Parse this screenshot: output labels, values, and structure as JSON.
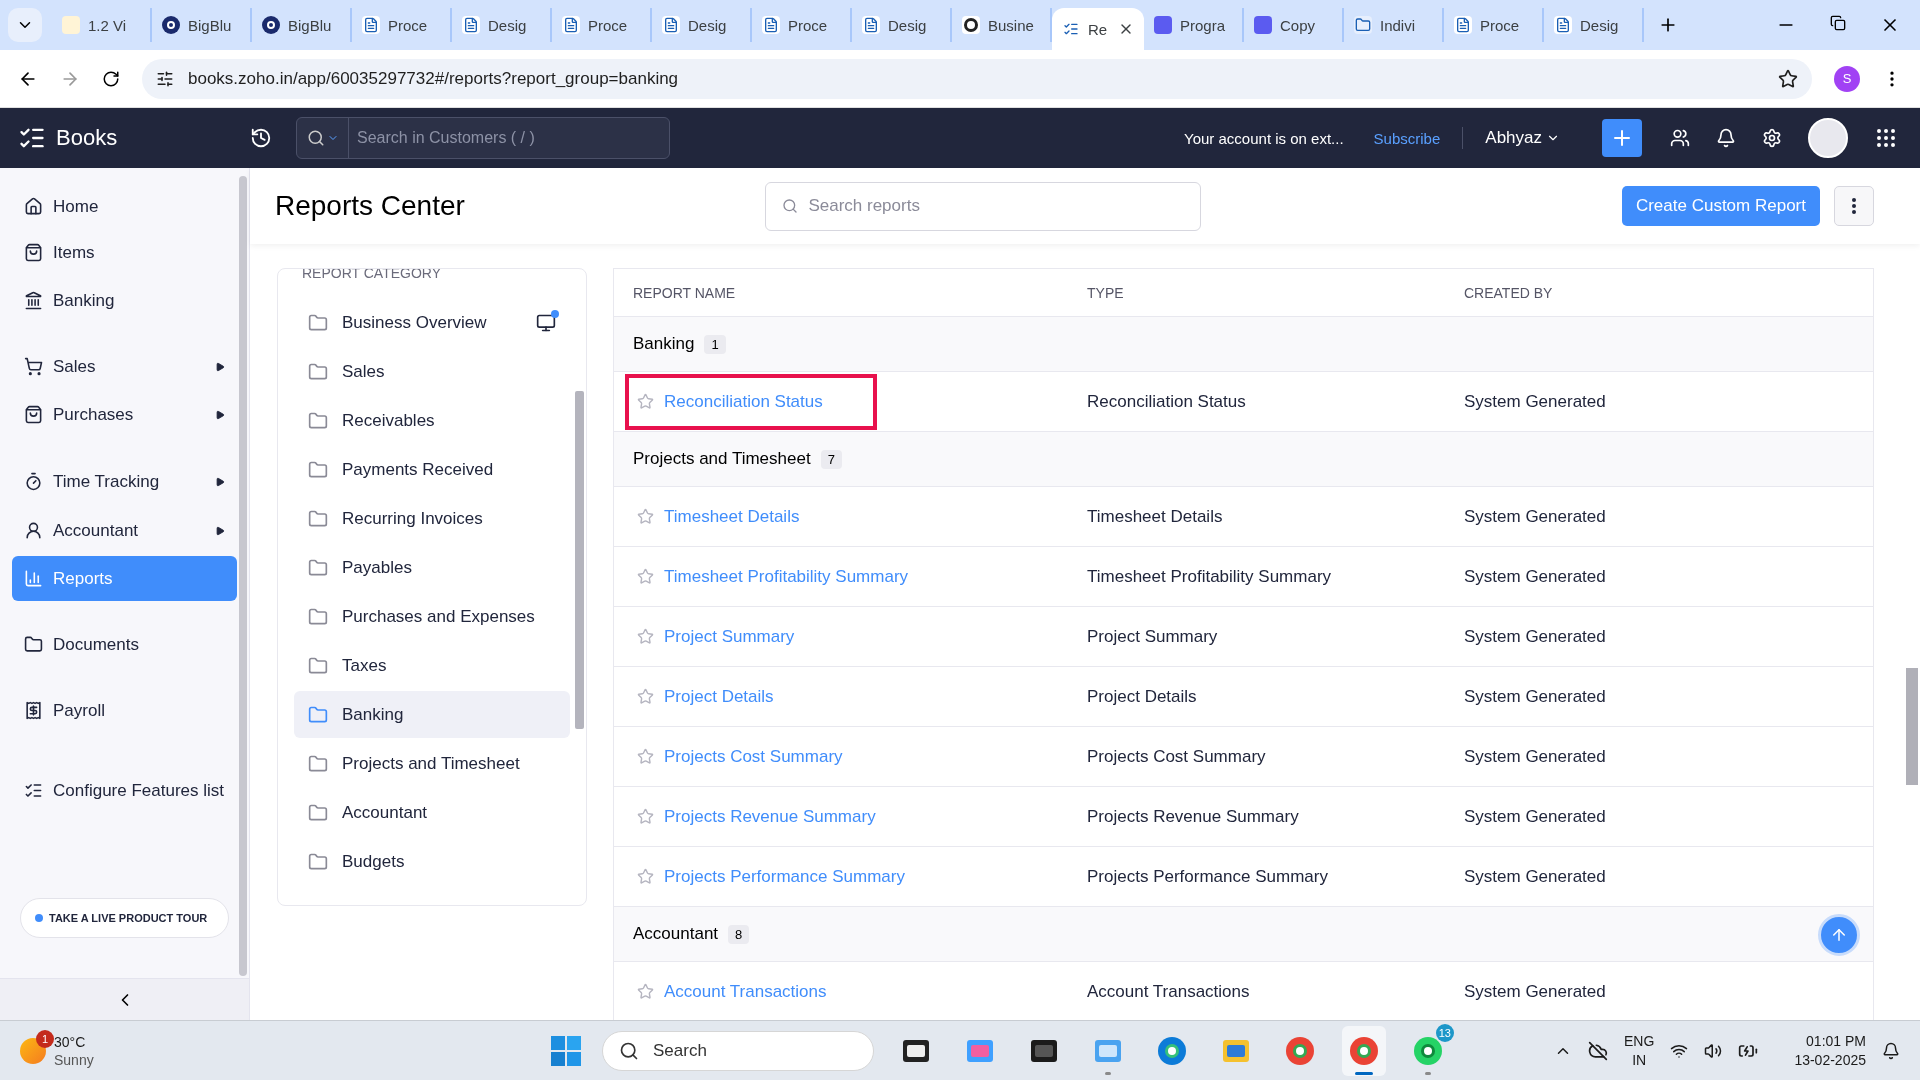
{
  "browser": {
    "tabs": [
      {
        "label": "1.2 Vi",
        "selected": false
      },
      {
        "label": "BigBlu",
        "selected": false
      },
      {
        "label": "BigBlu",
        "selected": false
      },
      {
        "label": "Proce",
        "selected": false
      },
      {
        "label": "Desig",
        "selected": false
      },
      {
        "label": "Proce",
        "selected": false
      },
      {
        "label": "Desig",
        "selected": false
      },
      {
        "label": "Proce",
        "selected": false
      },
      {
        "label": "Desig",
        "selected": false
      },
      {
        "label": "Busine",
        "selected": false
      },
      {
        "label": "Re",
        "selected": true
      },
      {
        "label": "Progra",
        "selected": false
      },
      {
        "label": "Copy",
        "selected": false
      },
      {
        "label": "Indivi",
        "selected": false
      },
      {
        "label": "Proce",
        "selected": false
      },
      {
        "label": "Desig",
        "selected": false
      }
    ],
    "url": "books.zoho.in/app/60035297732#/reports?report_group=banking",
    "profile": "S"
  },
  "app_header": {
    "brand": "Books",
    "search_placeholder": "Search in Customers ( / )",
    "notice": "Your account is on ext...",
    "subscribe": "Subscribe",
    "org": "Abhyaz"
  },
  "sidebar": {
    "items": [
      {
        "label": "Home",
        "submenu": false,
        "selected": false
      },
      {
        "label": "Items",
        "submenu": false,
        "selected": false
      },
      {
        "label": "Banking",
        "submenu": false,
        "selected": false
      },
      {
        "label": "Sales",
        "submenu": true,
        "selected": false
      },
      {
        "label": "Purchases",
        "submenu": true,
        "selected": false
      },
      {
        "label": "Time Tracking",
        "submenu": true,
        "selected": false
      },
      {
        "label": "Accountant",
        "submenu": true,
        "selected": false
      },
      {
        "label": "Reports",
        "submenu": false,
        "selected": true
      },
      {
        "label": "Documents",
        "submenu": false,
        "selected": false
      },
      {
        "label": "Payroll",
        "submenu": false,
        "selected": false
      },
      {
        "label": "Configure Features list",
        "submenu": false,
        "selected": false
      }
    ],
    "tour": "TAKE A LIVE PRODUCT TOUR"
  },
  "page": {
    "title": "Reports Center",
    "search_placeholder": "Search reports",
    "create_button": "Create Custom Report"
  },
  "categories": {
    "heading": "REPORT CATEGORY",
    "items": [
      {
        "label": "Business Overview",
        "selected": false,
        "video": true
      },
      {
        "label": "Sales",
        "selected": false,
        "video": false
      },
      {
        "label": "Receivables",
        "selected": false,
        "video": false
      },
      {
        "label": "Payments Received",
        "selected": false,
        "video": false
      },
      {
        "label": "Recurring Invoices",
        "selected": false,
        "video": false
      },
      {
        "label": "Payables",
        "selected": false,
        "video": false
      },
      {
        "label": "Purchases and Expenses",
        "selected": false,
        "video": false
      },
      {
        "label": "Taxes",
        "selected": false,
        "video": false
      },
      {
        "label": "Banking",
        "selected": true,
        "video": false
      },
      {
        "label": "Projects and Timesheet",
        "selected": false,
        "video": false
      },
      {
        "label": "Accountant",
        "selected": false,
        "video": false
      },
      {
        "label": "Budgets",
        "selected": false,
        "video": false
      }
    ]
  },
  "table": {
    "columns": [
      "REPORT NAME",
      "TYPE",
      "CREATED BY"
    ],
    "groups": [
      {
        "name": "Banking",
        "count": "1",
        "rows": [
          {
            "name": "Reconciliation Status",
            "type": "Reconciliation Status",
            "created_by": "System Generated",
            "highlighted": true
          }
        ]
      },
      {
        "name": "Projects and Timesheet",
        "count": "7",
        "rows": [
          {
            "name": "Timesheet Details",
            "type": "Timesheet Details",
            "created_by": "System Generated",
            "highlighted": false
          },
          {
            "name": "Timesheet Profitability Summary",
            "type": "Timesheet Profitability Summary",
            "created_by": "System Generated",
            "highlighted": false
          },
          {
            "name": "Project Summary",
            "type": "Project Summary",
            "created_by": "System Generated",
            "highlighted": false
          },
          {
            "name": "Project Details",
            "type": "Project Details",
            "created_by": "System Generated",
            "highlighted": false
          },
          {
            "name": "Projects Cost Summary",
            "type": "Projects Cost Summary",
            "created_by": "System Generated",
            "highlighted": false
          },
          {
            "name": "Projects Revenue Summary",
            "type": "Projects Revenue Summary",
            "created_by": "System Generated",
            "highlighted": false
          },
          {
            "name": "Projects Performance Summary",
            "type": "Projects Performance Summary",
            "created_by": "System Generated",
            "highlighted": false
          }
        ]
      },
      {
        "name": "Accountant",
        "count": "8",
        "rows": [
          {
            "name": "Account Transactions",
            "type": "Account Transactions",
            "created_by": "System Generated",
            "highlighted": false
          }
        ]
      }
    ]
  },
  "taskbar": {
    "weather": {
      "temp": "30°C",
      "condition": "Sunny",
      "badge": "1"
    },
    "search": "Search",
    "apps": [
      {
        "running": false,
        "selected": false
      },
      {
        "running": false,
        "selected": false
      },
      {
        "running": false,
        "selected": false
      },
      {
        "running": true,
        "selected": false
      },
      {
        "running": false,
        "selected": false
      },
      {
        "running": false,
        "selected": false
      },
      {
        "running": false,
        "selected": false
      },
      {
        "running": true,
        "selected": true
      },
      {
        "running": true,
        "selected": false,
        "badge": "13"
      }
    ],
    "lang": "ENG",
    "region": "IN",
    "time": "01:01 PM",
    "date": "13-02-2025"
  }
}
